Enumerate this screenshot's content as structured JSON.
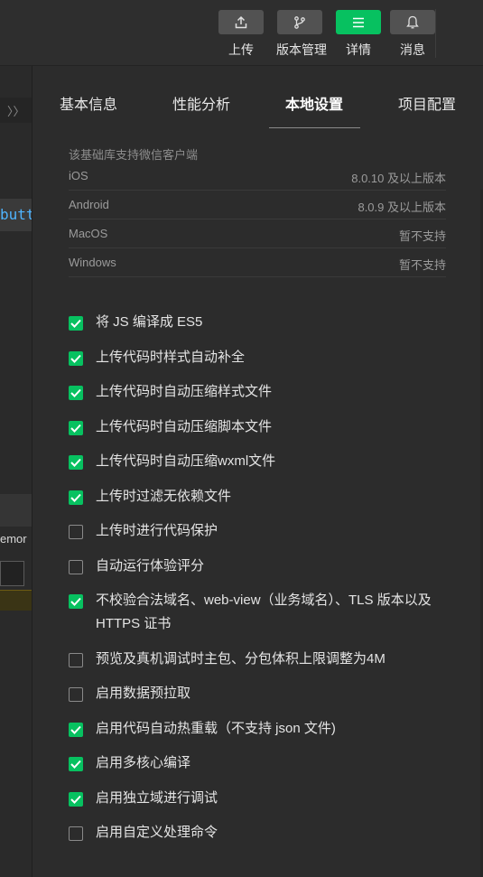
{
  "toolbar": {
    "buttons": [
      {
        "label": "上传",
        "icon": "upload-icon",
        "active": false
      },
      {
        "label": "版本管理",
        "icon": "branch-icon",
        "active": false
      },
      {
        "label": "详情",
        "icon": "menu-icon",
        "active": true
      },
      {
        "label": "消息",
        "icon": "bell-icon",
        "active": false
      }
    ]
  },
  "background": {
    "code_fragment": "butt",
    "memory_fragment": "emor"
  },
  "tabs": [
    {
      "label": "基本信息",
      "active": false
    },
    {
      "label": "性能分析",
      "active": false
    },
    {
      "label": "本地设置",
      "active": true
    },
    {
      "label": "项目配置",
      "active": false
    }
  ],
  "support": {
    "title": "该基础库支持微信客户端",
    "rows": [
      {
        "platform": "iOS",
        "value": "8.0.10 及以上版本"
      },
      {
        "platform": "Android",
        "value": "8.0.9 及以上版本"
      },
      {
        "platform": "MacOS",
        "value": "暂不支持"
      },
      {
        "platform": "Windows",
        "value": "暂不支持"
      }
    ]
  },
  "options": [
    {
      "label": "将 JS 编译成 ES5",
      "checked": true
    },
    {
      "label": "上传代码时样式自动补全",
      "checked": true
    },
    {
      "label": "上传代码时自动压缩样式文件",
      "checked": true
    },
    {
      "label": "上传代码时自动压缩脚本文件",
      "checked": true
    },
    {
      "label": "上传代码时自动压缩wxml文件",
      "checked": true
    },
    {
      "label": "上传时过滤无依赖文件",
      "checked": true
    },
    {
      "label": "上传时进行代码保护",
      "checked": false
    },
    {
      "label": "自动运行体验评分",
      "checked": false
    },
    {
      "label": "不校验合法域名、web-view（业务域名）、TLS 版本以及 HTTPS 证书",
      "checked": true
    },
    {
      "label": "预览及真机调试时主包、分包体积上限调整为4M",
      "checked": false
    },
    {
      "label": "启用数据预拉取",
      "checked": false
    },
    {
      "label": "启用代码自动热重载（不支持 json 文件)",
      "checked": true
    },
    {
      "label": "启用多核心编译",
      "checked": true
    },
    {
      "label": "启用独立域进行调试",
      "checked": true
    },
    {
      "label": "启用自定义处理命令",
      "checked": false
    }
  ],
  "colors": {
    "accent": "#07c160",
    "background": "#2c2c2c"
  }
}
